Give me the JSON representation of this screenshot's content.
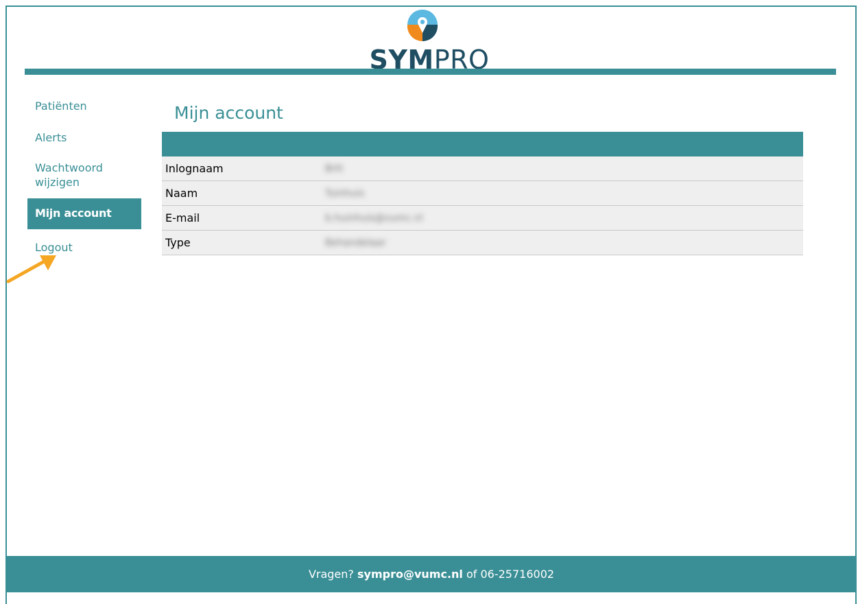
{
  "header": {
    "logo": {
      "text_bold": "SYM",
      "text_light": "PRO"
    }
  },
  "sidebar": {
    "items": [
      {
        "label": "Patiënten",
        "active": false
      },
      {
        "label": "Alerts",
        "active": false
      },
      {
        "label": "Wachtwoord wijzigen",
        "active": false
      },
      {
        "label": "Mijn account",
        "active": true
      },
      {
        "label": "Logout",
        "active": false
      }
    ]
  },
  "main": {
    "title": "Mijn account",
    "account_table": {
      "rows": [
        {
          "label": "Inlognaam",
          "value": "Brtt"
        },
        {
          "label": "Naam",
          "value": "Tuinhuis"
        },
        {
          "label": "E-mail",
          "value": "b.huinhuis@vumc.nl"
        },
        {
          "label": "Type",
          "value": "Behandelaar"
        }
      ]
    }
  },
  "footer": {
    "prefix": "Vragen?",
    "email": "sympro@vumc.nl",
    "suffix": "of 06-25716002"
  },
  "colors": {
    "primary": "#3a8f96",
    "logo_dark": "#1f4e63",
    "logo_light_blue": "#5bb8e0",
    "logo_orange": "#f08a1c",
    "arrow": "#f5a623",
    "row_bg": "#efefef"
  }
}
